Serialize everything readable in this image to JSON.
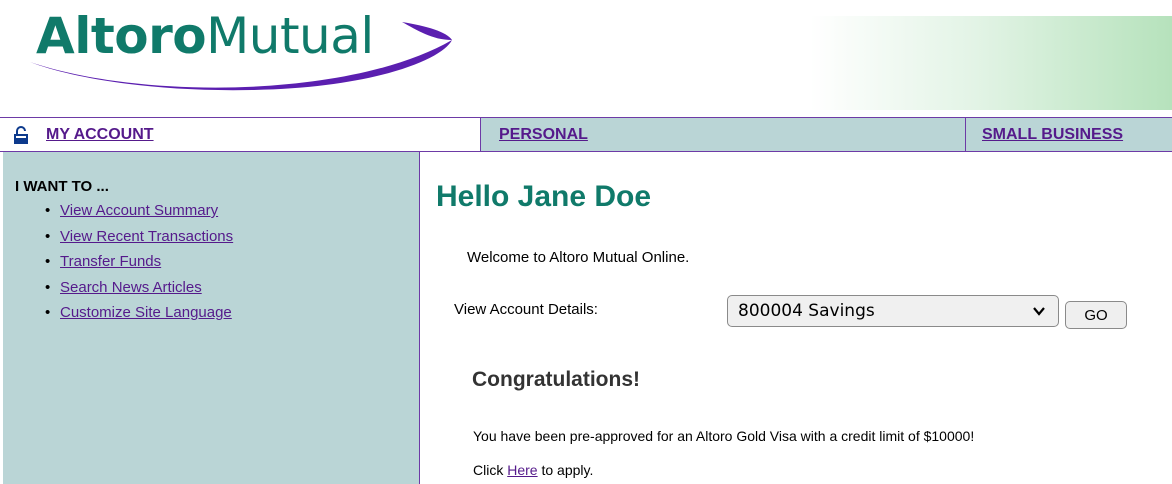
{
  "brand": {
    "logo_bold": "Altoro",
    "logo_light": "Mutual"
  },
  "nav": {
    "my_account": "MY ACCOUNT",
    "personal": "PERSONAL",
    "small_business": "SMALL BUSINESS"
  },
  "sidebar": {
    "title": "I WANT TO ...",
    "items": [
      {
        "label": "View Account Summary"
      },
      {
        "label": "View Recent Transactions"
      },
      {
        "label": "Transfer Funds"
      },
      {
        "label": "Search News Articles"
      },
      {
        "label": "Customize Site Language"
      }
    ]
  },
  "main": {
    "greeting": "Hello Jane Doe",
    "welcome": "Welcome to Altoro Mutual Online.",
    "details_label": "View Account Details:",
    "selected_account": "800004 Savings",
    "go_label": "GO",
    "congrats": "Congratulations!",
    "preapproved": "You have been pre-approved for an Altoro Gold Visa with a credit limit of $10000!",
    "click_prefix": "Click",
    "here_link": "Here",
    "click_suffix": "to apply."
  },
  "colors": {
    "teal": "#107a6a",
    "nav_bg": "#bad5d6",
    "link": "#551a8b",
    "border": "#6d3aa6"
  }
}
